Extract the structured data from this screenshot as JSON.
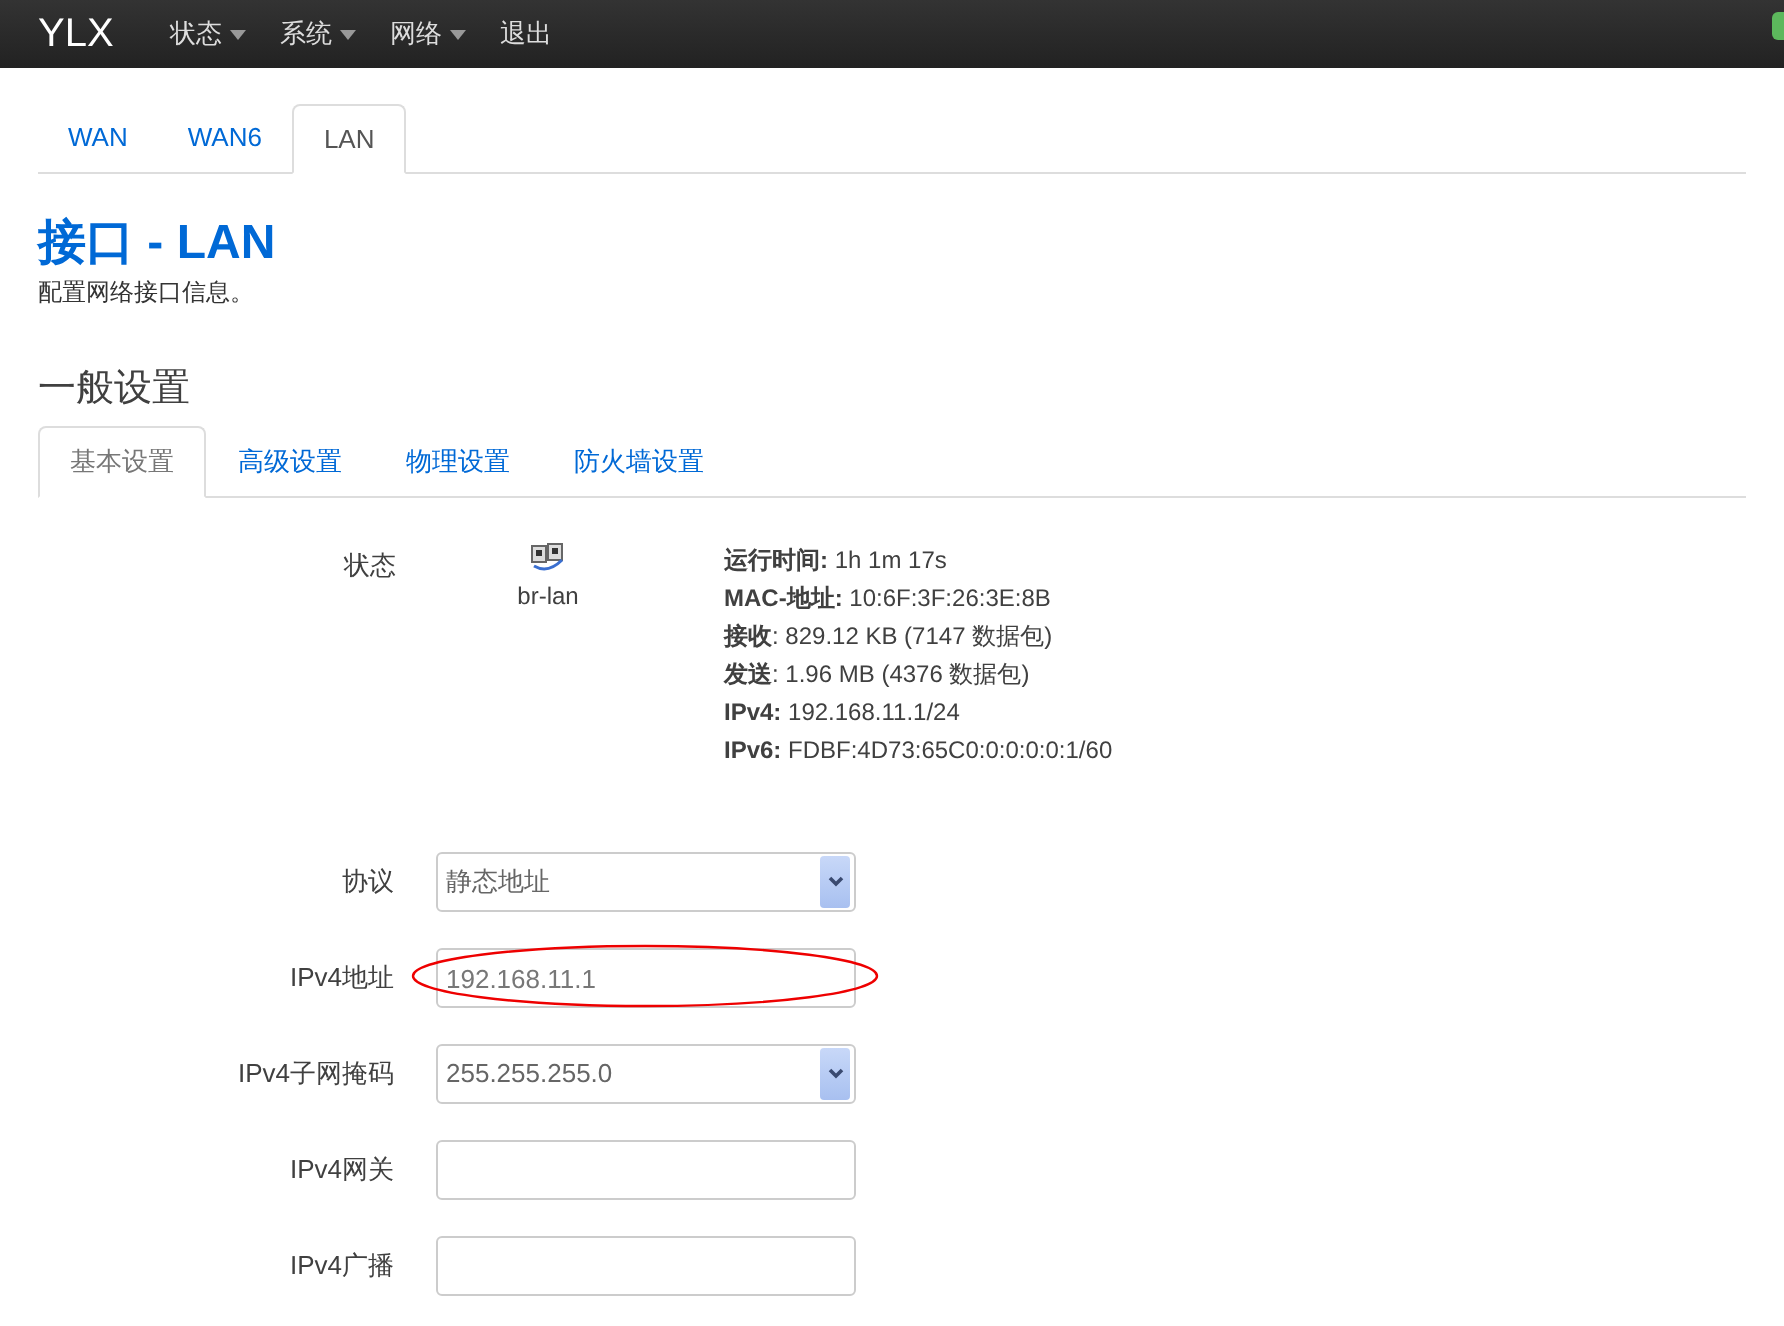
{
  "navbar": {
    "brand": "YLX",
    "menus": [
      {
        "label": "状态",
        "dropdown": true
      },
      {
        "label": "系统",
        "dropdown": true
      },
      {
        "label": "网络",
        "dropdown": true
      },
      {
        "label": "退出",
        "dropdown": false
      }
    ]
  },
  "interface_tabs": [
    {
      "label": "WAN",
      "selected": false
    },
    {
      "label": "WAN6",
      "selected": false
    },
    {
      "label": "LAN",
      "selected": true
    }
  ],
  "page": {
    "title": "接口 - LAN",
    "description": "配置网络接口信息。"
  },
  "section": {
    "title": "一般设置",
    "tabs": [
      {
        "label": "基本设置",
        "selected": true
      },
      {
        "label": "高级设置",
        "selected": false
      },
      {
        "label": "物理设置",
        "selected": false
      },
      {
        "label": "防火墙设置",
        "selected": false
      }
    ]
  },
  "status": {
    "label": "状态",
    "device": "br-lan",
    "lines": [
      "**运行时间:** 1h 1m 17s",
      "**MAC-地址:** 10:6F:3F:26:3E:8B",
      "**接收**: 829.12 KB (7147 数据包)",
      "**发送**: 1.96 MB (4376 数据包)",
      "**IPv4:** 192.168.11.1/24",
      "**IPv6:** FDBF:4D73:65C0:0:0:0:0:1/60"
    ]
  },
  "fields": [
    {
      "label": "协议",
      "kind": "select",
      "value": "静态地址",
      "highlighted": false
    },
    {
      "label": "IPv4地址",
      "kind": "text",
      "value": "192.168.11.1",
      "highlighted": true
    },
    {
      "label": "IPv4子网掩码",
      "kind": "select",
      "value": "255.255.255.0",
      "highlighted": false
    },
    {
      "label": "IPv4网关",
      "kind": "text",
      "highlighted": false
    },
    {
      "label": "IPv4广播",
      "kind": "text",
      "highlighted": false
    }
  ]
}
